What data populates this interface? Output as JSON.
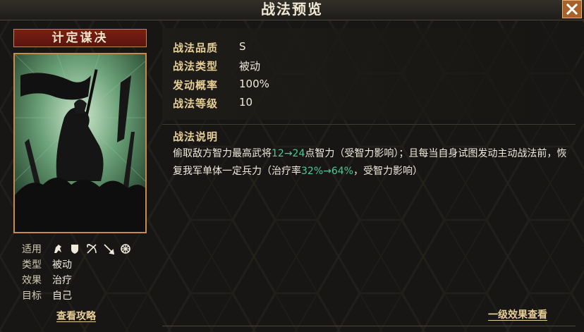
{
  "window": {
    "title": "战法预览",
    "close_label": "✕"
  },
  "card": {
    "name": "计定谋决",
    "portrait_icon": "commander-with-banner-illustration"
  },
  "meta": {
    "apply_label": "适用",
    "apply_icons": [
      "cavalry-icon",
      "shield-icon",
      "bow-icon",
      "spear-icon",
      "wheel-icon"
    ],
    "type_label": "类型",
    "type_value": "被动",
    "effect_label": "效果",
    "effect_value": "治疗",
    "target_label": "目标",
    "target_value": "自己",
    "guide_link": "查看攻略"
  },
  "stats": {
    "quality_label": "战法品质",
    "quality_value": "S",
    "type_label": "战法类型",
    "type_value": "被动",
    "rate_label": "发动概率",
    "rate_value": "100%",
    "level_label": "战法等级",
    "level_value": "10"
  },
  "description": {
    "label": "战法说明",
    "seg1": "偷取敌方智力最高武将",
    "hl1": "12→24",
    "seg2": "点智力（受智力影响）；且每当自身试图发动主动战法前，恢复我军单体一定兵力（治疗率",
    "hl2": "32%→64%",
    "seg3": "，受智力影响）"
  },
  "footer": {
    "level1_link": "一级效果查看"
  },
  "colors": {
    "accent_gold": "#e6cf96",
    "highlight_green": "#4fc89a",
    "title_red": "#7a2015",
    "close_orange": "#a9612a"
  }
}
